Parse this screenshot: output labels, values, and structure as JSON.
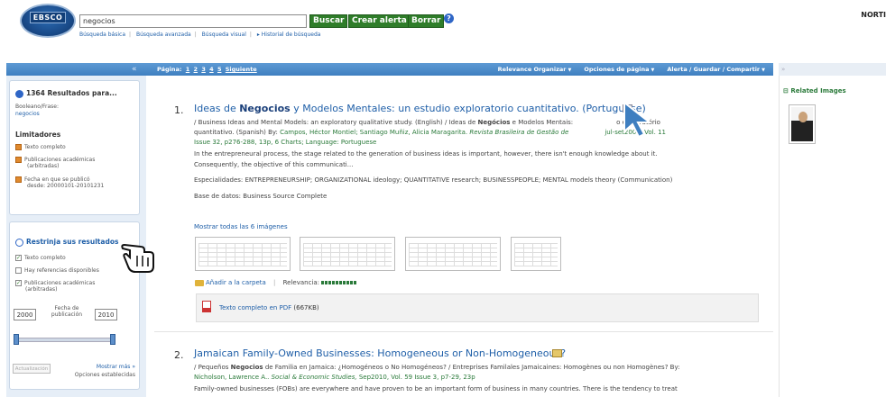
{
  "header": {
    "logo": "EBSCO",
    "search_value": "negocios",
    "buttons": {
      "search": "Buscar",
      "alert": "Crear alerta",
      "clear": "Borrar"
    },
    "help": "?",
    "corner_text": "NORTI",
    "links": [
      "Búsqueda básica",
      "Búsqueda avanzada",
      "Búsqueda visual",
      "Historial de búsqueda"
    ]
  },
  "toolbar": {
    "pages_label": "Página:",
    "pages": [
      "1",
      "2",
      "3",
      "4",
      "5"
    ],
    "next": "Siguiente",
    "menus": [
      "Relevance Organizar",
      "Opciones de página",
      "Alerta / Guardar / Compartir"
    ]
  },
  "sidebar": {
    "results_count": "1364 Resultados para...",
    "query_label": "Booleano/Frase:",
    "query_value": "negocios",
    "limiters_title": "Limitadores",
    "limiters": [
      {
        "line1": "Texto completo",
        "line2": ""
      },
      {
        "line1": "Publicaciones académicas",
        "line2": "(arbitradas)"
      },
      {
        "line1": "Fecha en que se publicó",
        "line2": "desde: 20000101-20101231"
      }
    ],
    "narrow_title": "Restrinja sus resultados",
    "checks": [
      {
        "label": "Texto completo",
        "label2": "",
        "checked": true
      },
      {
        "label": "Hay referencias disponibles",
        "label2": "",
        "checked": false
      },
      {
        "label": "Publicaciones académicas",
        "label2": "(arbitradas)",
        "checked": true
      }
    ],
    "year_from": "2000",
    "year_to": "2010",
    "date_label1": "Fecha de",
    "date_label2": "publicación",
    "update_btn": "Actualización",
    "show_more": "Mostrar más »",
    "options_set": "Opciones establecidas"
  },
  "results": [
    {
      "num": "1.",
      "title_pre": "Ideas de ",
      "title_bold": "Negocios",
      "title_post": " y Modelos Mentales: un estudio exploratorio cuantitativo. (Portuguese)",
      "alt_line1a": "/ Business Ideas and Mental Models: an exploratory qualitative study. (English) / Ideas de ",
      "alt_line1b": "Negócios",
      "alt_line1c": " e Modelos Mentais:",
      "alt_line1d": "o exploratório",
      "alt_line2a": "quantitativo. (Spanish) By: ",
      "alt_line2b": "Campos, Héctor Montiel; Santiago Muñiz, Alicia Maragarita.",
      "alt_line2c": " Revista Brasileira de Gestão de",
      "alt_line2d": "jul-set2009, Vol. 11",
      "alt_line3": "Issue 32, p276-288, 13p, 6 Charts; Language: Portuguese",
      "abstract1": "In the entrepreneural process, the stage related to the generation of business ideas is important, however, there isn't enough knowledge about it.",
      "abstract2": "Consequently, the objective of this communicati...",
      "subjects": "Especialidades: ENTREPRENEURSHIP; ORGANIZATIONAL ideology; QUANTITATIVE research; BUSINESSPEOPLE; MENTAL models theory (Communication)",
      "database": "Base de datos: Business Source Complete",
      "images_link": "Mostrar todas las 6 imágenes",
      "folder": "Añadir a la carpeta",
      "relevance": "Relevancia:",
      "pdf": "Texto completo en PDF",
      "pdf_size": "(667KB)"
    },
    {
      "num": "2.",
      "title": "Jamaican Family-Owned Businesses: Homogeneous or Non-Homogeneous?",
      "alt_line1a": "/ Pequeños ",
      "alt_line1b": "Negocios",
      "alt_line1c": " de Familia en Jamaica: ¿Homogéneos o No Homogéneos? / Entreprises Familales Jamaicaines: Homogènes ou non Homogènes? By:",
      "alt_line2a": "Nicholson, Lawrence A..",
      "alt_line2b": " Social & Economic Studies,",
      "alt_line2c": " Sep2010, Vol. 59 Issue 3, p7-29, 23p",
      "abstract": "Family-owned businesses (FOBs) are everywhere and have proven to be an important form of business in many countries. There is the tendency to treat"
    }
  ],
  "right": {
    "title": "Related Images"
  },
  "colors": {
    "bar": "#3f7fc0",
    "link": "#1f5fa8",
    "button": "#2f7d2a",
    "accent": "#e08a2e"
  }
}
